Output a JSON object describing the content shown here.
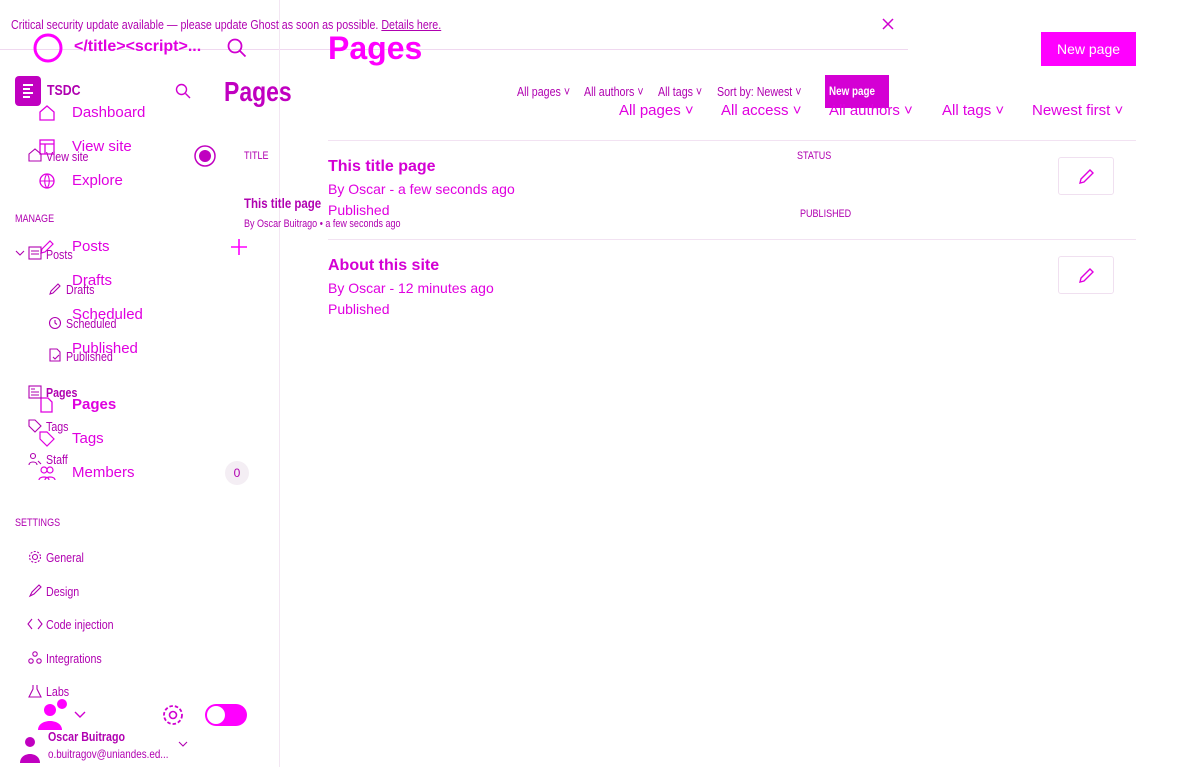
{
  "banner": {
    "message": "Critical security update available — please update Ghost as soon as possible.",
    "link": "Details here."
  },
  "site_a": {
    "title": "</title><script>...",
    "page_title": "Pages",
    "new_page": "New page",
    "nav": {
      "dashboard": "Dashboard",
      "view_site": "View site",
      "explore": "Explore",
      "posts": "Posts",
      "drafts": "Drafts",
      "scheduled": "Scheduled",
      "published": "Published",
      "pages": "Pages",
      "tags": "Tags",
      "members": "Members",
      "members_count": "0"
    },
    "filters": {
      "all_pages": "All pages",
      "all_access": "All access",
      "all_authors": "All authors",
      "all_tags": "All tags",
      "sort": "Newest first"
    },
    "rows": [
      {
        "title": "This title page",
        "meta": "By Oscar - a few seconds ago",
        "status": "Published"
      },
      {
        "title": "About this site",
        "meta": "By Oscar - 12 minutes ago",
        "status": "Published"
      }
    ]
  },
  "site_b": {
    "title": "TSDC",
    "page_title": "Pages",
    "new_page": "New page",
    "nav": {
      "view_site": "View site",
      "manage_heading": "MANAGE",
      "posts": "Posts",
      "drafts": "Drafts",
      "scheduled": "Scheduled",
      "published": "Published",
      "pages": "Pages",
      "tags": "Tags",
      "staff": "Staff",
      "settings_heading": "SETTINGS",
      "general": "General",
      "design": "Design",
      "code_injection": "Code injection",
      "integrations": "Integrations",
      "labs": "Labs"
    },
    "filters": {
      "all_pages": "All pages",
      "all_authors": "All authors",
      "all_tags": "All tags",
      "sort": "Sort by: Newest"
    },
    "table": {
      "title_header": "TITLE",
      "status_header": "STATUS",
      "row_title": "This title page",
      "row_meta": "By Oscar Buitrago • a few seconds ago",
      "row_status": "PUBLISHED"
    },
    "user": {
      "name": "Oscar Buitrago",
      "email": "o.buitragov@uniandes.ed..."
    }
  },
  "colors": {
    "accent": "#ff00ff",
    "text": "#e000e0",
    "bg": "#ffffff"
  },
  "icons": [
    "close-icon",
    "search-icon",
    "home-icon",
    "view-site-icon",
    "globe-icon",
    "pencil-icon",
    "plus-icon",
    "clock-icon",
    "published-icon",
    "pages-icon",
    "tag-icon",
    "members-icon",
    "gear-icon",
    "chevron-down-icon",
    "edit-icon"
  ]
}
